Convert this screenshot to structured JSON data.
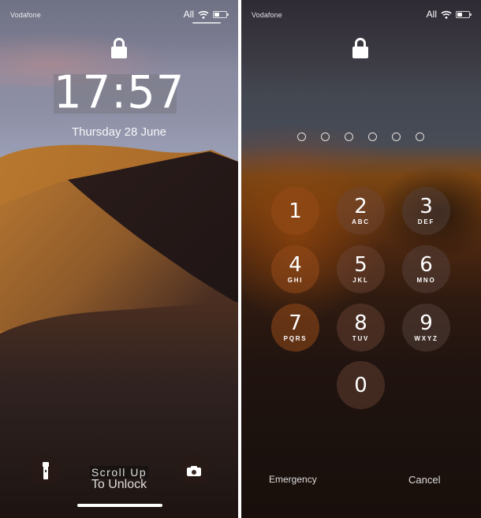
{
  "lock_screen": {
    "status_bar": {
      "carrier": "Vodafone",
      "network": "All",
      "wifi_icon": "wifi-icon",
      "battery_icon": "battery-icon"
    },
    "lock_icon": "padlock-icon",
    "time": "17:57",
    "date": "Thursday 28 June",
    "flashlight_icon": "flashlight-icon",
    "camera_icon": "camera-icon",
    "unlock_hint_line1": "Scroll Up",
    "unlock_hint_line2": "To Unlock"
  },
  "passcode_screen": {
    "status_bar": {
      "carrier": "Vodafone",
      "network": "All",
      "wifi_icon": "wifi-icon",
      "battery_icon": "battery-icon"
    },
    "lock_icon": "padlock-icon",
    "passcode_length": 6,
    "passcode_entered": 0,
    "keys": [
      {
        "digit": "1",
        "letters": ""
      },
      {
        "digit": "2",
        "letters": "ABC"
      },
      {
        "digit": "3",
        "letters": "DEF"
      },
      {
        "digit": "4",
        "letters": "GHI"
      },
      {
        "digit": "5",
        "letters": "JKL"
      },
      {
        "digit": "6",
        "letters": "MNO"
      },
      {
        "digit": "7",
        "letters": "PQRS"
      },
      {
        "digit": "8",
        "letters": "TUV"
      },
      {
        "digit": "9",
        "letters": "WXYZ"
      },
      {
        "digit": "0",
        "letters": ""
      }
    ],
    "emergency_label": "Emergency",
    "cancel_label": "Cancel"
  }
}
